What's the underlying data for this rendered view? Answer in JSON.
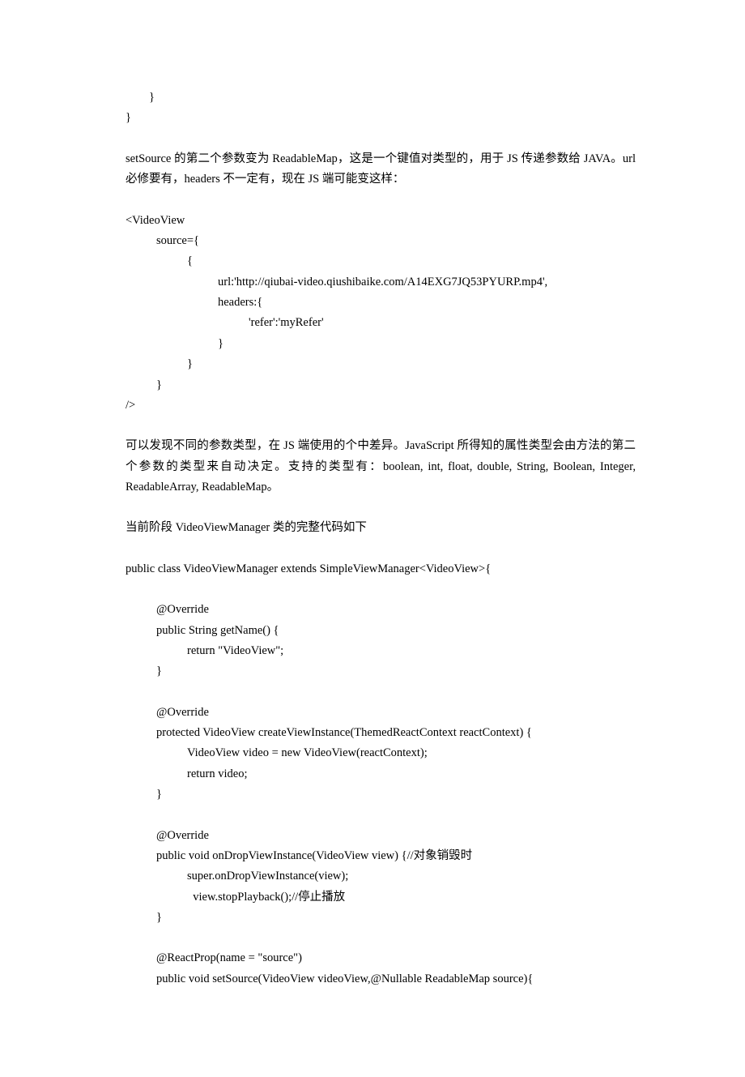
{
  "lines": {
    "l0": "        }",
    "l1": "}",
    "p1": "setSource 的第二个参数变为 ReadableMap，这是一个键值对类型的，用于 JS 传递参数给 JAVA。url 必修要有，headers 不一定有，现在 JS 端可能变这样：",
    "cv1": "<VideoView",
    "cv2": "source={",
    "cv3": "{",
    "cv4": "url:'http://qiubai-video.qiushibaike.com/A14EXG7JQ53PYURP.mp4',",
    "cv5": "headers:{",
    "cv6": "'refer':'myRefer'",
    "cv7": "}",
    "cv8": "}",
    "cv9": "}",
    "cv10": "/>",
    "p2": "可以发现不同的参数类型，在 JS 端使用的个中差异。JavaScript 所得知的属性类型会由方法的第二个参数的类型来自动决定。支持的类型有：boolean, int, float, double, String, Boolean, Integer, ReadableArray, ReadableMap。",
    "p3": "当前阶段 VideoViewManager 类的完整代码如下",
    "jc0": "public class VideoViewManager extends SimpleViewManager<VideoView>{",
    "jc1": "@Override",
    "jc2": "public String getName() {",
    "jc3": "return \"VideoView\";",
    "jc4": "}",
    "jc5": "@Override",
    "jc6": "protected VideoView createViewInstance(ThemedReactContext reactContext) {",
    "jc7": "VideoView video = new VideoView(reactContext);",
    "jc8": "return video;",
    "jc9": "}",
    "jc10": "@Override",
    "jc11": "public void onDropViewInstance(VideoView view) {//对象销毁时",
    "jc12": "super.onDropViewInstance(view);",
    "jc13": "  view.stopPlayback();//停止播放",
    "jc14": "}",
    "jc15": "@ReactProp(name = \"source\")",
    "jc16": "public void setSource(VideoView videoView,@Nullable ReadableMap source){"
  }
}
